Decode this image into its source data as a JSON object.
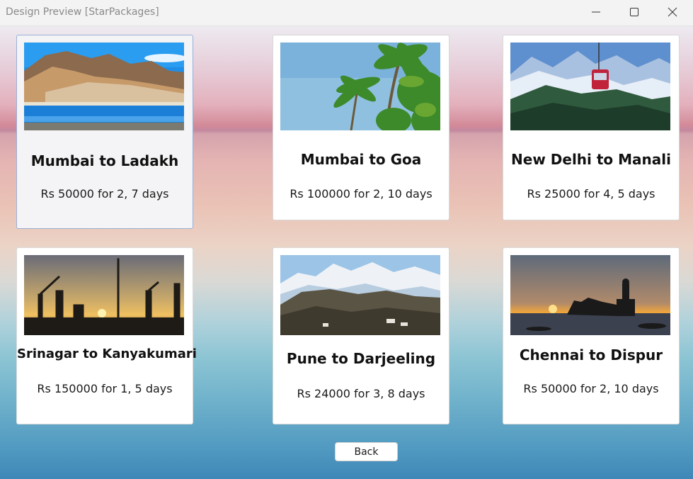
{
  "window": {
    "title": "Design Preview [StarPackages]",
    "controls": [
      "minimize-icon",
      "maximize-icon",
      "close-icon"
    ]
  },
  "packages": [
    {
      "title": "Mumbai to Ladakh",
      "price": "Rs 50000 for 2, 7 days"
    },
    {
      "title": "Mumbai to Goa",
      "price": "Rs 100000 for 2, 10 days"
    },
    {
      "title": "New Delhi to Manali",
      "price": "Rs 25000 for 4, 5 days"
    },
    {
      "title": "Srinagar to Kanyakumari",
      "price": "Rs 150000 for 1, 5 days"
    },
    {
      "title": "Pune to Darjeeling",
      "price": "Rs 24000 for 3, 8 days"
    },
    {
      "title": "Chennai to Dispur",
      "price": "Rs 50000 for 2, 10 days"
    }
  ],
  "back_label": "Back",
  "colors": {
    "titlebar": "#f3f3f3",
    "title_text": "#8a8a8a",
    "card_bg": "#ffffff",
    "selected_card_bg": "#f4f4f6",
    "selected_border": "#9ab0d8"
  }
}
